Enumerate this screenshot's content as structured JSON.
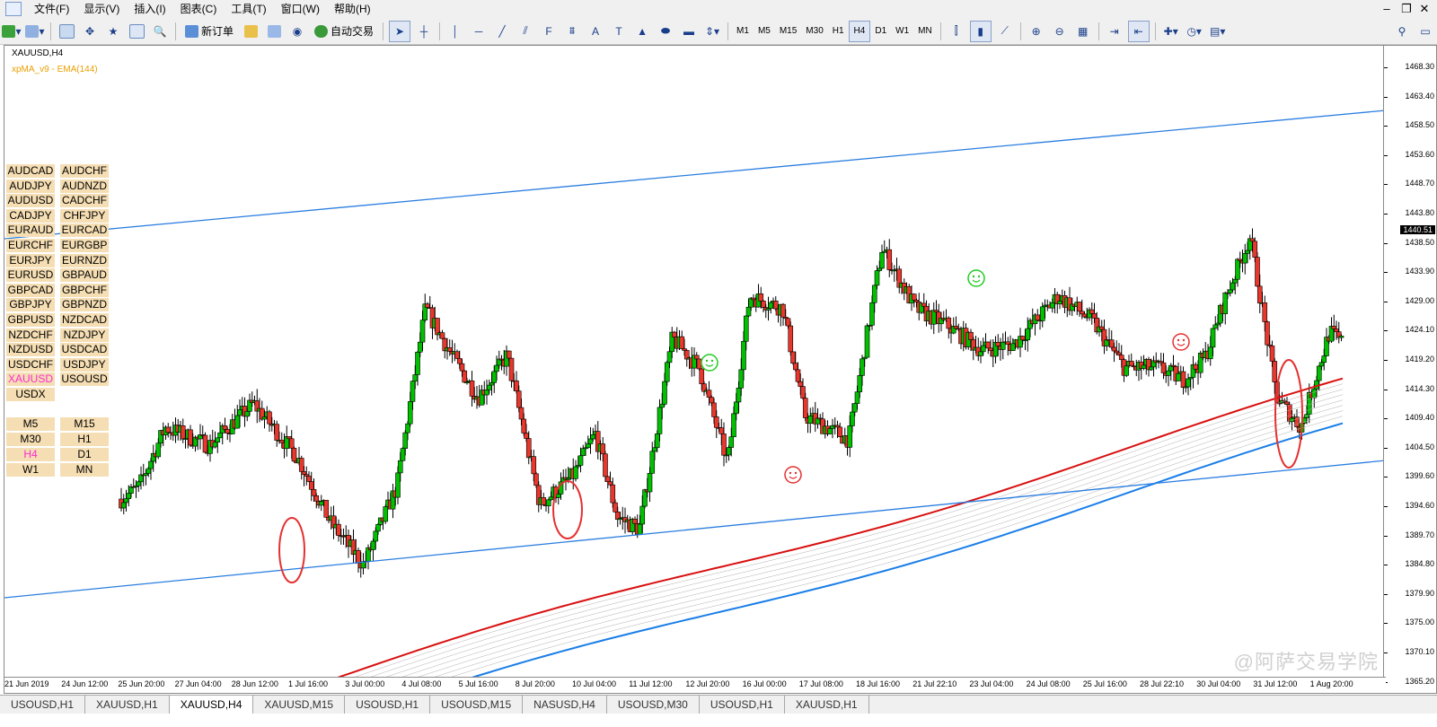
{
  "menu": [
    "文件(F)",
    "显示(V)",
    "插入(I)",
    "图表(C)",
    "工具(T)",
    "窗口(W)",
    "帮助(H)"
  ],
  "toolbar": {
    "new_order": "新订单",
    "auto_trading": "自动交易",
    "timeframes": [
      "M1",
      "M5",
      "M15",
      "M30",
      "H1",
      "H4",
      "D1",
      "W1",
      "MN"
    ],
    "active_timeframe": "H4"
  },
  "chart": {
    "title": "XAUUSD,H4",
    "indicator": "xpMA_v9 - EMA(144)",
    "current_price": "1440.51",
    "price_labels": [
      "1468.30",
      "1463.40",
      "1458.50",
      "1453.60",
      "1448.70",
      "1443.80",
      "1438.50",
      "1433.90",
      "1429.00",
      "1424.10",
      "1419.20",
      "1414.30",
      "1409.40",
      "1404.50",
      "1399.60",
      "1394.60",
      "1389.70",
      "1384.80",
      "1379.90",
      "1375.00",
      "1370.10",
      "1365.20"
    ],
    "time_labels": [
      "21 Jun 2019",
      "24 Jun 12:00",
      "25 Jun 20:00",
      "27 Jun 04:00",
      "28 Jun 12:00",
      "1 Jul 16:00",
      "3 Jul 00:00",
      "4 Jul 08:00",
      "5 Jul 16:00",
      "8 Jul 20:00",
      "10 Jul 04:00",
      "11 Jul 12:00",
      "12 Jul 20:00",
      "16 Jul 00:00",
      "17 Jul 08:00",
      "18 Jul 16:00",
      "21 Jul 22:10",
      "23 Jul 04:00",
      "24 Jul 08:00",
      "25 Jul 16:00",
      "28 Jul 22:10",
      "30 Jul 04:00",
      "31 Jul 12:00",
      "1 Aug 20:00"
    ],
    "watermark": "@阿萨交易学院",
    "colors": {
      "bull": "#00c000",
      "bear": "#e8372c",
      "trend": "#2a7ee0",
      "ema_upper": "#d81010",
      "ema_lower": "#1a7ee8",
      "annot": "#e53030",
      "smile_green": "#22cc22"
    }
  },
  "pairs": [
    [
      "AUDCAD",
      "AUDCHF"
    ],
    [
      "AUDJPY",
      "AUDNZD"
    ],
    [
      "AUDUSD",
      "CADCHF"
    ],
    [
      "CADJPY",
      "CHFJPY"
    ],
    [
      "EURAUD",
      "EURCAD"
    ],
    [
      "EURCHF",
      "EURGBP"
    ],
    [
      "EURJPY",
      "EURNZD"
    ],
    [
      "EURUSD",
      "GBPAUD"
    ],
    [
      "GBPCAD",
      "GBPCHF"
    ],
    [
      "GBPJPY",
      "GBPNZD"
    ],
    [
      "GBPUSD",
      "NZDCAD"
    ],
    [
      "NZDCHF",
      "NZDJPY"
    ],
    [
      "NZDUSD",
      "USDCAD"
    ],
    [
      "USDCHF",
      "USDJPY"
    ],
    [
      "XAUUSD",
      "USOUSD"
    ],
    [
      "USDX",
      ""
    ]
  ],
  "highlight_pair": "XAUUSD",
  "tf_buttons": [
    [
      "M5",
      "M15"
    ],
    [
      "M30",
      "H1"
    ],
    [
      "H4",
      "D1"
    ],
    [
      "W1",
      "MN"
    ]
  ],
  "highlight_tf": "H4",
  "tabs": [
    "USOUSD,H1",
    "XAUUSD,H1",
    "XAUUSD,H4",
    "XAUUSD,M15",
    "USOUSD,H1",
    "USOUSD,M15",
    "NASUSD,H4",
    "USOUSD,M30",
    "USOUSD,H1",
    "XAUUSD,H1"
  ],
  "active_tab": "XAUUSD,H4"
}
